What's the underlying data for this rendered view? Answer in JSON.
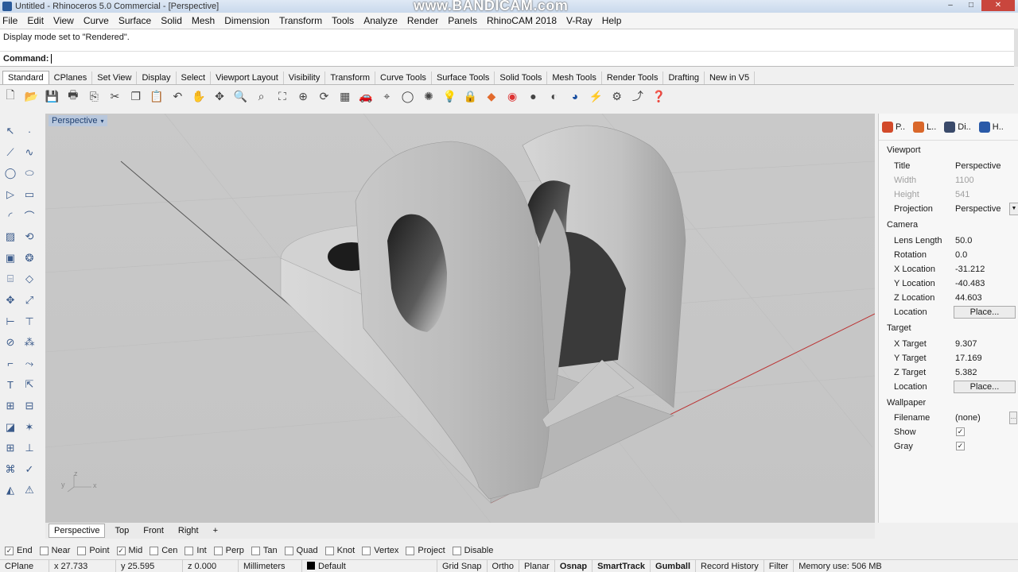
{
  "window": {
    "title": "Untitled - Rhinoceros 5.0 Commercial - [Perspective]",
    "watermark": "www.BANDICAM.com",
    "min_label": "–",
    "max_label": "□",
    "close_label": "✕"
  },
  "menu": [
    "File",
    "Edit",
    "View",
    "Curve",
    "Surface",
    "Solid",
    "Mesh",
    "Dimension",
    "Transform",
    "Tools",
    "Analyze",
    "Render",
    "Panels",
    "RhinoCAM 2018",
    "V-Ray",
    "Help"
  ],
  "command": {
    "history": "Display mode set to \"Rendered\".",
    "prompt": "Command:"
  },
  "toolbar_tabs": [
    "Standard",
    "CPlanes",
    "Set View",
    "Display",
    "Select",
    "Viewport Layout",
    "Visibility",
    "Transform",
    "Curve Tools",
    "Surface Tools",
    "Solid Tools",
    "Mesh Tools",
    "Render Tools",
    "Drafting",
    "New in V5"
  ],
  "toolbar_icons": [
    "new-icon",
    "open-icon",
    "save-icon",
    "print-icon",
    "import-icon",
    "cut-icon",
    "copy-icon",
    "paste-icon",
    "undo-icon",
    "pan-icon",
    "move-view-icon",
    "zoom-icon",
    "zoom-window-icon",
    "zoom-extents-icon",
    "zoom-selected-icon",
    "rotate-view-icon",
    "grid-icon",
    "car-icon",
    "osnap-icon",
    "circle-icon",
    "light-icon",
    "lightbulb-icon",
    "lock-icon",
    "layer-icon",
    "color-wheel-icon",
    "sphere-icon",
    "shaded-sphere-icon",
    "render-sphere-icon",
    "wand-icon",
    "gear-icon",
    "extract-icon",
    "help-icon"
  ],
  "viewport": {
    "title": "Perspective",
    "dropdown": "▾",
    "axis_labels": [
      "y",
      "z",
      "x"
    ]
  },
  "viewport_tabs": [
    "Perspective",
    "Top",
    "Front",
    "Right",
    "+"
  ],
  "osnaps": [
    {
      "label": "End",
      "checked": true
    },
    {
      "label": "Near",
      "checked": false
    },
    {
      "label": "Point",
      "checked": false
    },
    {
      "label": "Mid",
      "checked": true
    },
    {
      "label": "Cen",
      "checked": false
    },
    {
      "label": "Int",
      "checked": false
    },
    {
      "label": "Perp",
      "checked": false
    },
    {
      "label": "Tan",
      "checked": false
    },
    {
      "label": "Quad",
      "checked": false
    },
    {
      "label": "Knot",
      "checked": false
    },
    {
      "label": "Vertex",
      "checked": false
    },
    {
      "label": "Project",
      "checked": false
    },
    {
      "label": "Disable",
      "checked": false
    }
  ],
  "status": {
    "cplane": "CPlane",
    "x": "x 27.733",
    "y": "y 25.595",
    "z": "z 0.000",
    "units": "Millimeters",
    "layer": "Default",
    "grid_snap": "Grid Snap",
    "ortho": "Ortho",
    "planar": "Planar",
    "osnap": "Osnap",
    "smarttrack": "SmartTrack",
    "gumball": "Gumball",
    "record_history": "Record History",
    "filter": "Filter",
    "memory": "Memory use: 506 MB"
  },
  "properties_panel": {
    "tabs": [
      {
        "label": "P..",
        "icon_color": "#d24a2a"
      },
      {
        "label": "L..",
        "icon_color": "#d9672a"
      },
      {
        "label": "Di..",
        "icon_color": "#3a4a6a"
      },
      {
        "label": "H..",
        "icon_color": "#2a5aa8"
      }
    ],
    "viewport_section": "Viewport",
    "title_label": "Title",
    "title_value": "Perspective",
    "width_label": "Width",
    "width_value": "1100",
    "height_label": "Height",
    "height_value": "541",
    "projection_label": "Projection",
    "projection_value": "Perspective",
    "camera_section": "Camera",
    "lens_label": "Lens Length",
    "lens_value": "50.0",
    "rotation_label": "Rotation",
    "rotation_value": "0.0",
    "xloc_label": "X Location",
    "xloc_value": "-31.212",
    "yloc_label": "Y Location",
    "yloc_value": "-40.483",
    "zloc_label": "Z Location",
    "zloc_value": "44.603",
    "location_label": "Location",
    "place_label": "Place...",
    "target_section": "Target",
    "xtarget_label": "X Target",
    "xtarget_value": "9.307",
    "ytarget_label": "Y Target",
    "ytarget_value": "17.169",
    "ztarget_label": "Z Target",
    "ztarget_value": "5.382",
    "target_location_label": "Location",
    "target_place_label": "Place...",
    "wallpaper_section": "Wallpaper",
    "filename_label": "Filename",
    "filename_value": "(none)",
    "show_label": "Show",
    "gray_label": "Gray"
  }
}
